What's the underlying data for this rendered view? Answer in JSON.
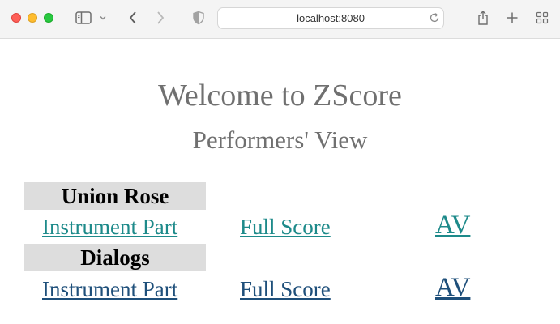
{
  "browser": {
    "url": "localhost:8080",
    "icons": {
      "sidebar": "sidebar-icon",
      "caret": "chevron-down-icon",
      "back": "chevron-left-icon",
      "forward": "chevron-right-icon",
      "privacy": "shield-icon",
      "reload": "reload-icon",
      "share": "share-icon",
      "new_tab": "plus-icon",
      "tab_overview": "grid-icon"
    }
  },
  "page": {
    "title": "Welcome to ZScore",
    "subtitle": "Performers' View"
  },
  "pieces": [
    {
      "name": "Union Rose",
      "instrument_part": "Instrument Part",
      "full_score": "Full Score",
      "av": "AV",
      "link_color": "#1d8a8a"
    },
    {
      "name": "Dialogs",
      "instrument_part": "Instrument Part",
      "full_score": "Full Score",
      "av": "AV",
      "link_color": "#1e4f7a"
    }
  ],
  "colors": {
    "heading": "#707070",
    "header_bg": "#dddddd"
  }
}
